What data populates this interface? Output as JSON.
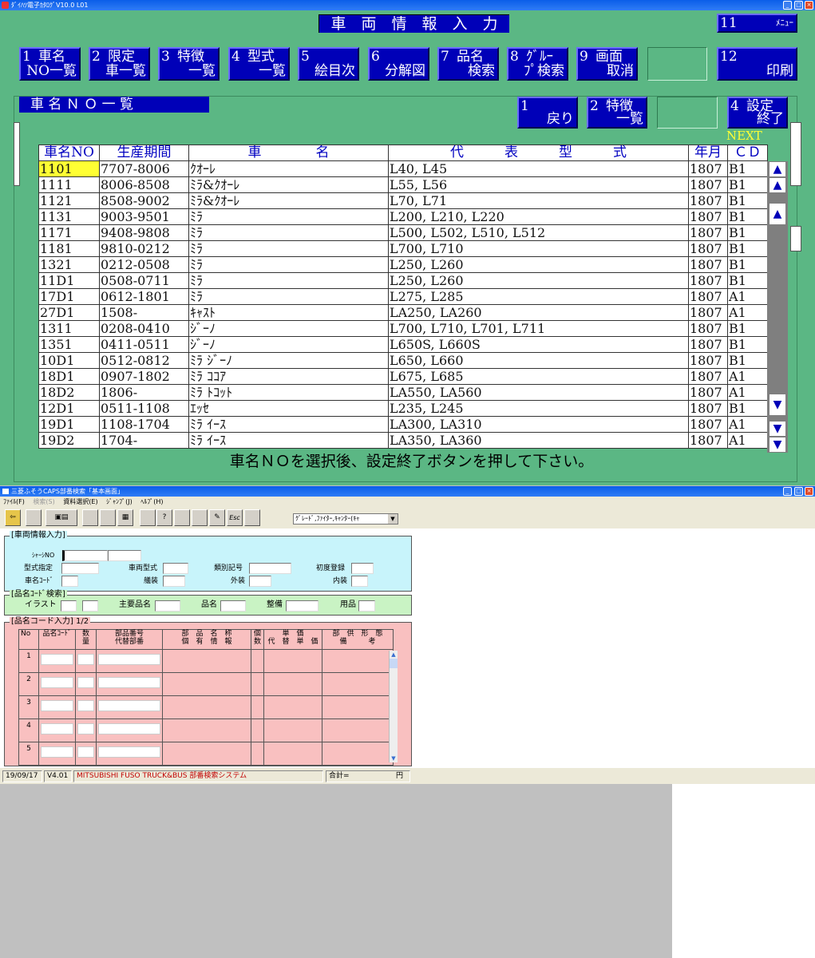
{
  "catalog_window": {
    "title": "ﾀﾞｲﾊﾂ電子ｶﾀﾛｸﾞV10.0 L01",
    "screen_title": "車　両　情　報　入　力",
    "nav": [
      {
        "n": "1",
        "l1": "車名",
        "l2": "NO一覧"
      },
      {
        "n": "2",
        "l1": "限定",
        "l2": "車一覧"
      },
      {
        "n": "3",
        "l1": "特徴",
        "l2": "一覧"
      },
      {
        "n": "4",
        "l1": "型式",
        "l2": "一覧"
      },
      {
        "n": "5",
        "l1": "",
        "l2": "絵目次"
      },
      {
        "n": "6",
        "l1": "",
        "l2": "分解図"
      },
      {
        "n": "7",
        "l1": "品名",
        "l2": "検索"
      },
      {
        "n": "8",
        "l1": "ｸﾞﾙｰ",
        "l2": "ﾌﾟ検索"
      },
      {
        "n": "9",
        "l1": "画面",
        "l2": "取消"
      }
    ],
    "menu_btn": {
      "n": "11",
      "label": "ﾒﾆｭｰ"
    },
    "print_btn": {
      "n": "12",
      "label": "印刷"
    },
    "list_title": "車 名 Ｎ Ｏ 一 覧",
    "back_btn": {
      "n": "1",
      "label": "戻り"
    },
    "feature_btn": {
      "n": "2",
      "l1": "特徴",
      "l2": "一覧"
    },
    "finish_btn": {
      "n": "4",
      "l1": "設定",
      "l2": "終了"
    },
    "next_label": "NEXT",
    "columns": [
      "車名NO",
      "生産期間",
      "車　　　　名",
      "代　　　表　　　型　　　式",
      "年月",
      "ＣＤ"
    ],
    "rows": [
      [
        "1101",
        "7707-8006",
        "ｸｵｰﾚ",
        "L40, L45",
        "1807",
        "B1"
      ],
      [
        "1111",
        "8006-8508",
        "ﾐﾗ&ｸｵｰﾚ",
        "L55, L56",
        "1807",
        "B1"
      ],
      [
        "1121",
        "8508-9002",
        "ﾐﾗ&ｸｵｰﾚ",
        "L70, L71",
        "1807",
        "B1"
      ],
      [
        "1131",
        "9003-9501",
        "ﾐﾗ",
        "L200, L210, L220",
        "1807",
        "B1"
      ],
      [
        "1171",
        "9408-9808",
        "ﾐﾗ",
        "L500, L502, L510, L512",
        "1807",
        "B1"
      ],
      [
        "1181",
        "9810-0212",
        "ﾐﾗ",
        "L700, L710",
        "1807",
        "B1"
      ],
      [
        "1321",
        "0212-0508",
        "ﾐﾗ",
        "L250, L260",
        "1807",
        "B1"
      ],
      [
        "11D1",
        "0508-0711",
        "ﾐﾗ",
        "L250, L260",
        "1807",
        "B1"
      ],
      [
        "17D1",
        "0612-1801",
        "ﾐﾗ",
        "L275, L285",
        "1807",
        "A1"
      ],
      [
        "27D1",
        "1508-",
        "ｷｬｽﾄ",
        "LA250, LA260",
        "1807",
        "A1"
      ],
      [
        "1311",
        "0208-0410",
        "ｼﾞｰﾉ",
        "L700, L710, L701, L711",
        "1807",
        "B1"
      ],
      [
        "1351",
        "0411-0511",
        "ｼﾞｰﾉ",
        "L650S, L660S",
        "1807",
        "B1"
      ],
      [
        "10D1",
        "0512-0812",
        "ﾐﾗ ｼﾞｰﾉ",
        "L650, L660",
        "1807",
        "B1"
      ],
      [
        "18D1",
        "0907-1802",
        "ﾐﾗ ｺｺｱ",
        "L675, L685",
        "1807",
        "A1"
      ],
      [
        "18D2",
        "1806-",
        "ﾐﾗ ﾄｺｯﾄ",
        "LA550, LA560",
        "1807",
        "A1"
      ],
      [
        "12D1",
        "0511-1108",
        "ｴｯｾ",
        "L235, L245",
        "1807",
        "B1"
      ],
      [
        "19D1",
        "1108-1704",
        "ﾐﾗ ｲｰｽ",
        "LA300, LA310",
        "1807",
        "A1"
      ],
      [
        "19D2",
        "1704-",
        "ﾐﾗ ｲｰｽ",
        "LA350, LA360",
        "1807",
        "A1"
      ]
    ],
    "instruction": "車名ＮＯを選択後、設定終了ボタンを押して下さい。",
    "arrow_up": "▲",
    "arrow_down": "▼"
  },
  "parts_window": {
    "title": "三菱ふそうCAPS部番検索「基本画面」",
    "menu": [
      "ﾌｧｲﾙ(F)",
      "検索(S)",
      "資料選択(E)",
      "ｼﾞｬﾝﾌﾟ(J)",
      "ﾍﾙﾌﾟ(H)"
    ],
    "toolbar_esc": "Esc",
    "dropdown_value": "ｸﾞﾚｰﾄﾞ,ﾌｧｲﾀｰ,ｷｬﾝﾀｰ(ｷｬ",
    "vehicle_section": "[車両情報入力]",
    "vehicle_labels": {
      "chassis": "ｼｬｰｼNO",
      "model_spec": "型式指定",
      "vehicle_type": "車両型式",
      "class_code": "類別記号",
      "first_reg": "初度登録",
      "name_code": "車名ｺｰﾄﾞ",
      "equipment": "艤装",
      "exterior": "外装",
      "interior": "内装"
    },
    "code_section": "[品名ｺｰﾄﾞ検索]",
    "code_labels": {
      "illust": "イラスト",
      "main_part": "主要品名",
      "part_name": "品名",
      "maintenance": "整備",
      "supplies": "用品"
    },
    "input_section": "[品名コード入力] 1/2",
    "table_headers": {
      "no": "No",
      "code": "品名ｺｰﾄﾞ",
      "qty1": "数",
      "qty2": "量",
      "partno1": "部品番号",
      "partno2": "代替部番",
      "name1": "部　品　名　称",
      "name2": "個　有　情　報",
      "pcs1": "個",
      "pcs2": "数",
      "price1": "単　価",
      "price2": "代　替　単　価",
      "supply1": "部　供　形　態",
      "supply2": "備　　　考"
    },
    "row_numbers": [
      "1",
      "2",
      "3",
      "4",
      "5"
    ],
    "status": {
      "date": "19/09/17",
      "version": "V4.01",
      "system": "MITSUBISHI FUSO TRUCK&BUS 部番検索システム",
      "total_label": "合計=",
      "total_unit": "円"
    }
  }
}
